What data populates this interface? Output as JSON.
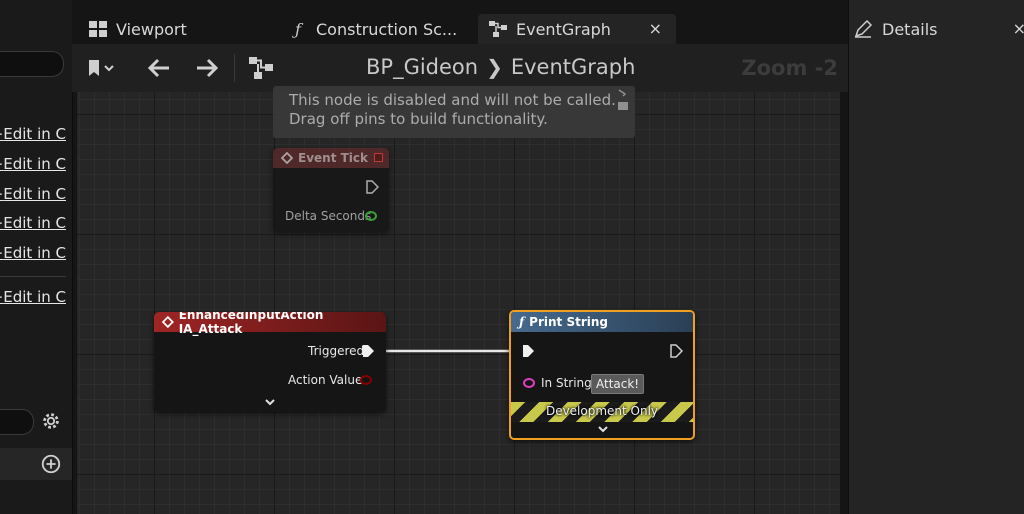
{
  "tabs": [
    {
      "label": "Viewport",
      "icon": "viewport-icon"
    },
    {
      "label": "Construction Sc...",
      "icon": "function-icon"
    },
    {
      "label": "EventGraph",
      "icon": "graph-icon",
      "active": true
    }
  ],
  "details": {
    "label": "Details",
    "icon": "pencil-icon"
  },
  "toolbar": {
    "breadcrumb_root": "BP_Gideon",
    "breadcrumb_leaf": "EventGraph",
    "zoom": "Zoom -2"
  },
  "left_panel": {
    "links": [
      "Edit in C++",
      "Edit in C++",
      "Edit in C++",
      "Edit in C++",
      "Edit in C++",
      "Edit in C++"
    ]
  },
  "tooltip": {
    "line1": "This node is disabled and will not be called.",
    "line2": "Drag off pins to build functionality."
  },
  "nodes": {
    "event_tick": {
      "title": "Event Tick",
      "pin_delta": "Delta Seconds",
      "disabled": true
    },
    "input_action": {
      "title": "EnhancedInputAction IA_Attack",
      "pin_triggered": "Triggered",
      "pin_action_value": "Action Value",
      "color": "#8a2020"
    },
    "print_string": {
      "title": "Print String",
      "pin_in_string": "In String",
      "in_string_value": "Attack!",
      "footer": "Development Only",
      "color": "#3a5a78",
      "selected_color": "#f0a020"
    }
  }
}
